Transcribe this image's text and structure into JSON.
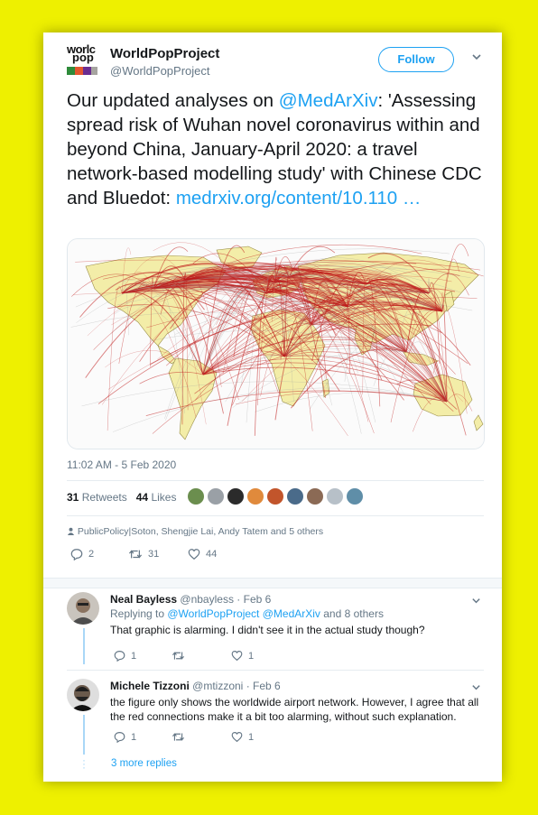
{
  "colors": {
    "background": "#eef000",
    "accent": "#1da1f2",
    "route_red": "#c0191a",
    "land": "#f3eda8"
  },
  "header": {
    "logo_text_1": "worlc",
    "logo_text_2": "pop",
    "name": "WorldPopProject",
    "handle": "@WorldPopProject",
    "follow_label": "Follow",
    "menu_icon": "chevron-down-icon"
  },
  "tweet": {
    "text_1": "Our updated analyses on ",
    "mention": "@MedArXiv",
    "text_2": ": 'Assessing spread risk of Wuhan novel coronavirus within and beyond China, January-April 2020: a travel network-based modelling study' with Chinese CDC and Bluedot: ",
    "link": "medrxiv.org/content/10.110 …",
    "image_icon": "world-air-network-map",
    "timestamp": "11:02 AM - 5 Feb 2020",
    "retweets_count": "31",
    "retweets_label": "Retweets",
    "likes_count": "44",
    "likes_label": "Likes",
    "liked_by": "PublicPolicy|Soton, Shengjie Lai, Andy Tatem and 5 others",
    "actions": {
      "replies": "2",
      "retweets": "31",
      "likes": "44"
    }
  },
  "replies": [
    {
      "name": "Neal Bayless",
      "handle": "@nbayless",
      "date": "· Feb 6",
      "replying_prefix": "Replying to ",
      "replying_mention_1": "@WorldPopProject",
      "replying_mention_2": "@MedArXiv",
      "replying_suffix": " and 8 others",
      "text": "That graphic is alarming. I didn't see it in the actual study though?",
      "counts": {
        "replies": "1",
        "retweets": "",
        "likes": "1"
      }
    },
    {
      "name": "Michele Tizzoni",
      "handle": "@mtizzoni",
      "date": "· Feb 6",
      "text": "the figure only shows the worldwide airport network. However, I agree that all the red connections make it a bit too alarming, without such explanation.",
      "counts": {
        "replies": "1",
        "retweets": "",
        "likes": "1"
      }
    }
  ],
  "more_replies": "3 more replies"
}
